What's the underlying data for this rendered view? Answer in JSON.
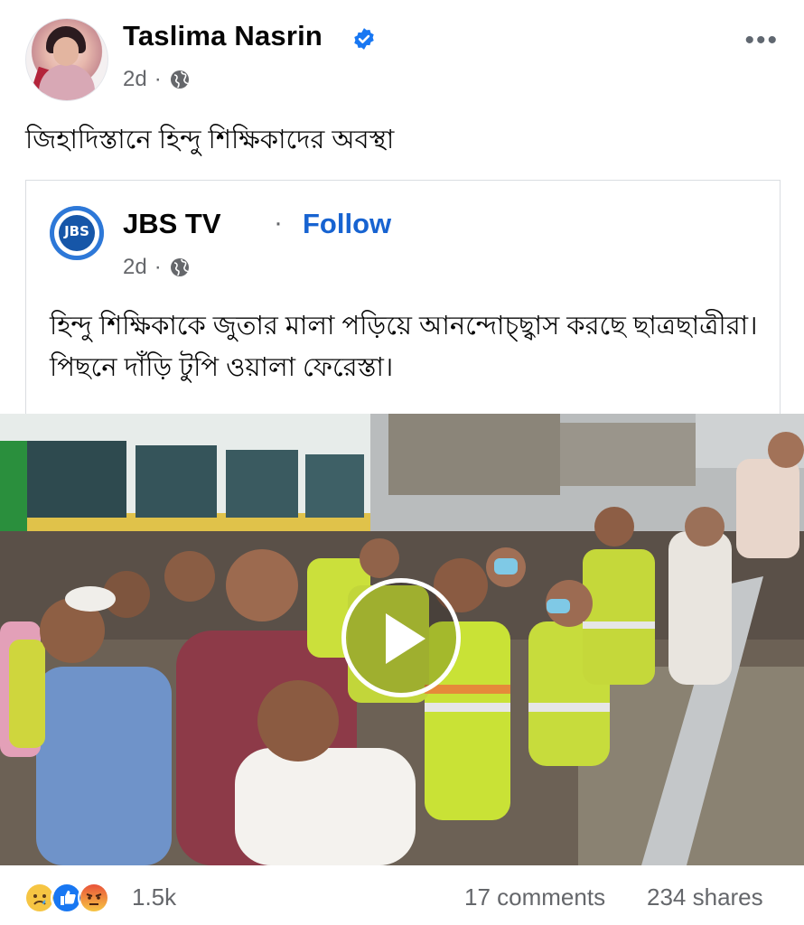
{
  "post": {
    "author": "Taslima Nasrin",
    "time": "2d",
    "more_icon": "more-horizontal-icon",
    "text": "জিহাদিস্তানে হিন্দু শিক্ষিকাদের অবস্থা"
  },
  "shared_post": {
    "page_name": "JBS TV",
    "page_logo_text": "JBS",
    "separator": "·",
    "follow_label": "Follow",
    "time": "2d",
    "text": "হিন্দু শিক্ষিকাকে জুতার মালা পড়িয়ে আনন্দোচ্ছ্বাস করছে ছাত্রছাত্রীরা। পিছনে দাঁড়ি টুপি ওয়ালা ফেরেস্তা।"
  },
  "video": {
    "play_icon": "play-icon"
  },
  "footer": {
    "reactions": [
      "sad-reaction-icon",
      "like-reaction-icon",
      "angry-reaction-icon"
    ],
    "reaction_count": "1.5k",
    "comments": "17 comments",
    "shares": "234 shares"
  },
  "colors": {
    "accent": "#1763d1",
    "secondary_text": "#65676b",
    "verified": "#1877f2"
  }
}
